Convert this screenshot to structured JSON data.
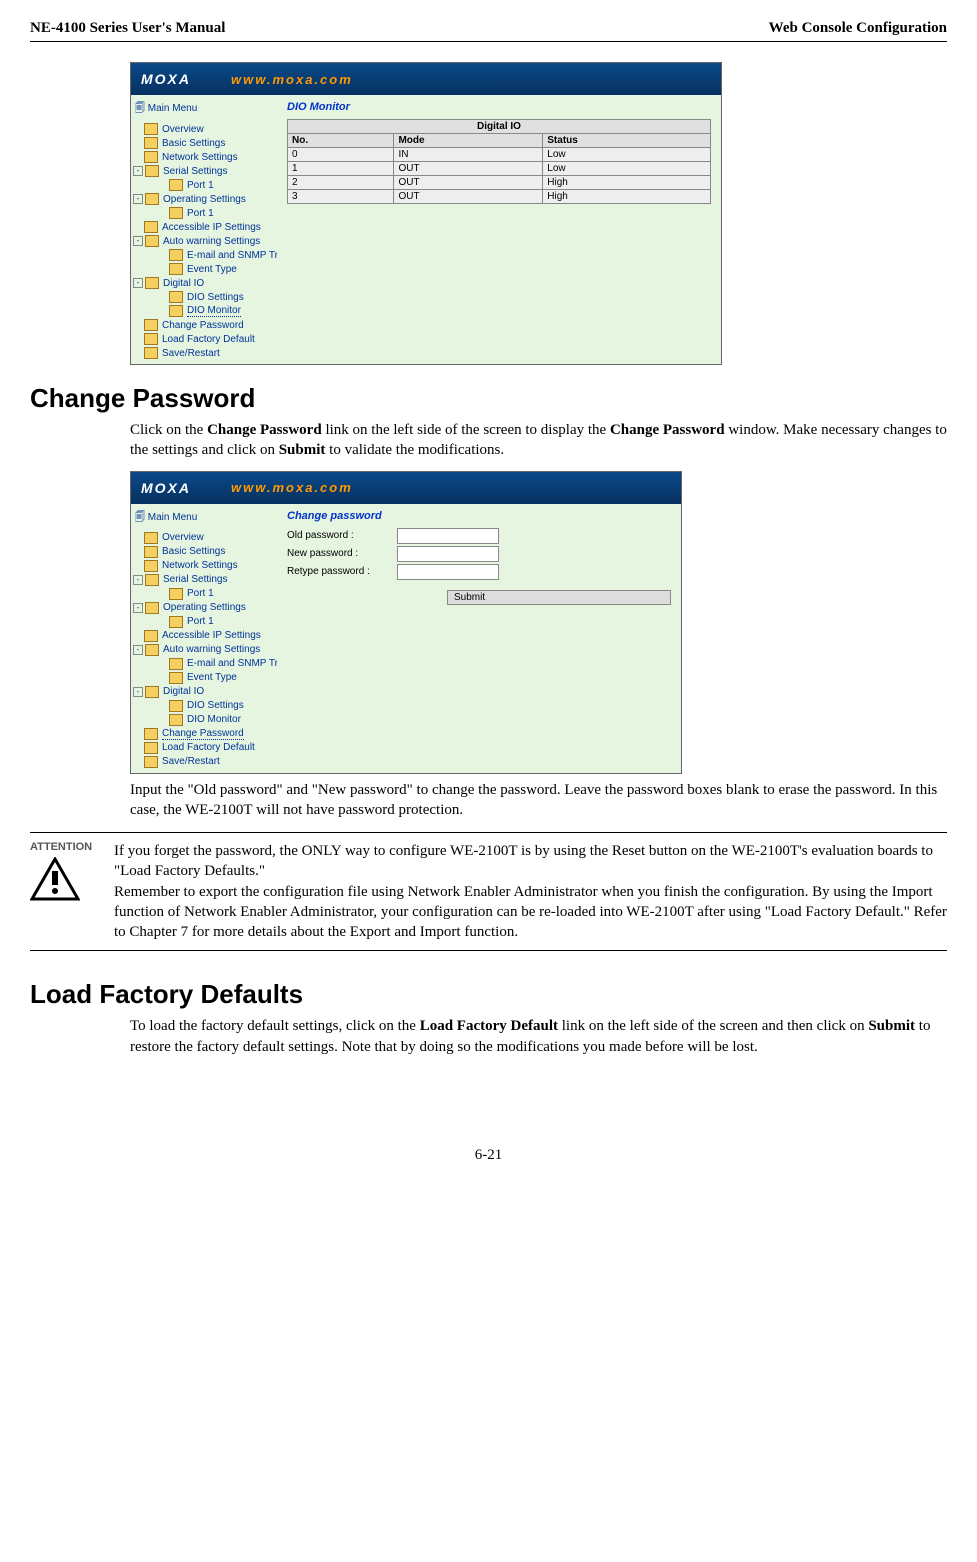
{
  "header": {
    "left": "NE-4100 Series User's Manual",
    "right": "Web Console Configuration"
  },
  "screenshot1": {
    "banner_logo": "MOXA",
    "banner_url": "www.moxa.com",
    "nav_title": "Main Menu",
    "nav": [
      {
        "label": "Overview",
        "type": "item"
      },
      {
        "label": "Basic Settings",
        "type": "item"
      },
      {
        "label": "Network Settings",
        "type": "item"
      },
      {
        "label": "Serial Settings",
        "type": "open"
      },
      {
        "label": "Port 1",
        "type": "child"
      },
      {
        "label": "Operating Settings",
        "type": "open"
      },
      {
        "label": "Port 1",
        "type": "child"
      },
      {
        "label": "Accessible IP Settings",
        "type": "item"
      },
      {
        "label": "Auto warning Settings",
        "type": "open"
      },
      {
        "label": "E-mail and SNMP Trap",
        "type": "child"
      },
      {
        "label": "Event Type",
        "type": "child"
      },
      {
        "label": "Digital IO",
        "type": "open"
      },
      {
        "label": "DIO Settings",
        "type": "child"
      },
      {
        "label": "DIO Monitor",
        "type": "child",
        "current": true
      },
      {
        "label": "Change Password",
        "type": "item"
      },
      {
        "label": "Load Factory Default",
        "type": "item"
      },
      {
        "label": "Save/Restart",
        "type": "item"
      }
    ],
    "content_title": "DIO Monitor",
    "table": {
      "caption": "Digital IO",
      "cols": [
        "No.",
        "Mode",
        "Status"
      ],
      "rows": [
        [
          "0",
          "IN",
          "Low"
        ],
        [
          "1",
          "OUT",
          "Low"
        ],
        [
          "2",
          "OUT",
          "High"
        ],
        [
          "3",
          "OUT",
          "High"
        ]
      ]
    }
  },
  "section1": {
    "heading": "Change Password",
    "intro_pre": "Click on the ",
    "intro_bold1": "Change Password",
    "intro_mid1": " link on the left side of the screen to display the ",
    "intro_bold2": "Change Password",
    "intro_mid2": " window. Make necessary changes to the settings and click on ",
    "intro_bold3": "Submit",
    "intro_post": " to validate the modifications."
  },
  "screenshot2": {
    "banner_logo": "MOXA",
    "banner_url": "www.moxa.com",
    "nav_title": "Main Menu",
    "nav": [
      {
        "label": "Overview",
        "type": "item"
      },
      {
        "label": "Basic Settings",
        "type": "item"
      },
      {
        "label": "Network Settings",
        "type": "item"
      },
      {
        "label": "Serial Settings",
        "type": "open"
      },
      {
        "label": "Port 1",
        "type": "child"
      },
      {
        "label": "Operating Settings",
        "type": "open"
      },
      {
        "label": "Port 1",
        "type": "child"
      },
      {
        "label": "Accessible IP Settings",
        "type": "item"
      },
      {
        "label": "Auto warning Settings",
        "type": "open"
      },
      {
        "label": "E-mail and SNMP Trap",
        "type": "child"
      },
      {
        "label": "Event Type",
        "type": "child"
      },
      {
        "label": "Digital IO",
        "type": "open"
      },
      {
        "label": "DIO Settings",
        "type": "child"
      },
      {
        "label": "DIO Monitor",
        "type": "child"
      },
      {
        "label": "Change Password",
        "type": "item",
        "current": true
      },
      {
        "label": "Load Factory Default",
        "type": "item"
      },
      {
        "label": "Save/Restart",
        "type": "item"
      }
    ],
    "content_title": "Change password",
    "fields": {
      "old": "Old password :",
      "new": "New password :",
      "retype": "Retype password :"
    },
    "submit": "Submit"
  },
  "para_after_ss2": "Input the \"Old password\" and \"New password\" to change the password. Leave the password boxes blank to erase the password. In this case, the WE-2100T will not have password protection.",
  "attention": {
    "label": "ATTENTION",
    "line1": "If you forget the password, the ONLY way to configure WE-2100T is by using the Reset button on the WE-2100T's evaluation boards to \"Load Factory Defaults.\"",
    "line2": "Remember to export the configuration file using Network Enabler Administrator when you finish the configuration. By using the Import function of Network Enabler Administrator, your configuration can be re-loaded into WE-2100T after using \"Load Factory Default.\" Refer to Chapter 7 for more details about the Export and Import function."
  },
  "section2": {
    "heading": "Load Factory Defaults",
    "para_pre": "To load the factory default settings, click on the ",
    "para_bold1": "Load Factory Default",
    "para_mid": " link on the left side of the screen and then click on ",
    "para_bold2": "Submit",
    "para_post": " to restore the factory default settings. Note that by doing so the modifications you made before will be lost."
  },
  "footer": "6-21"
}
